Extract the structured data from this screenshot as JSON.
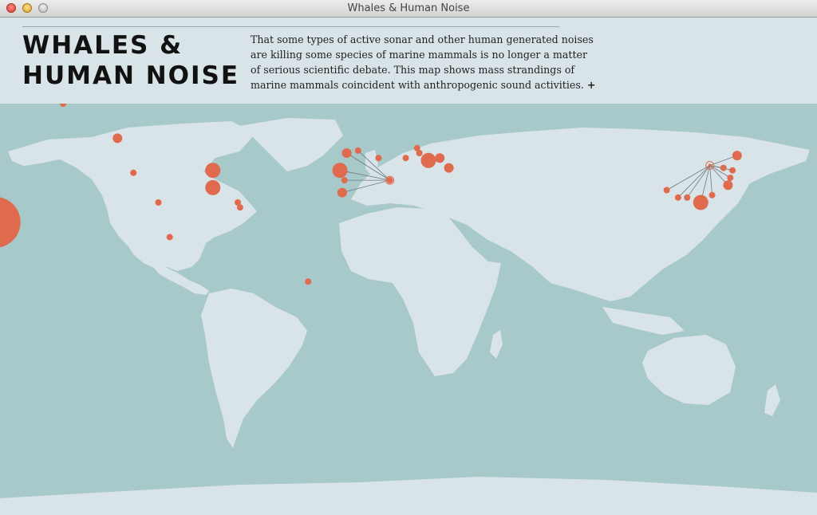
{
  "window": {
    "title": "Whales & Human Noise"
  },
  "header": {
    "title_line1": "WHALES &",
    "title_line2": "HUMAN NOISE",
    "intro_lines": [
      "That some types of active sonar and other human generated noises",
      "are killing some species of marine mammals is no longer a matter",
      "of serious scientific debate.  This map shows mass strandings of",
      "marine mammals coincident with anthropogenic sound activities."
    ],
    "more_label": "+"
  },
  "colors": {
    "ocean": "#a8c9ca",
    "land": "#d9e4e8",
    "marker": "#e06a4e",
    "leader": "#6f7a7d"
  },
  "markers": [
    {
      "lon": -178,
      "lat": 12,
      "size": 8
    },
    {
      "lon": -148,
      "lat": 60,
      "size": 1
    },
    {
      "lon": -124,
      "lat": 46,
      "size": 2
    },
    {
      "lon": -117,
      "lat": 32,
      "size": 1
    },
    {
      "lon": -106,
      "lat": 20,
      "size": 1
    },
    {
      "lon": -82,
      "lat": 33,
      "size": 3
    },
    {
      "lon": -82,
      "lat": 26,
      "size": 3
    },
    {
      "lon": -71,
      "lat": 20,
      "size": 1
    },
    {
      "lon": -70,
      "lat": 18,
      "size": 1
    },
    {
      "lon": -101,
      "lat": 6,
      "size": 1
    },
    {
      "lon": -40,
      "lat": -12,
      "size": 1
    },
    {
      "lon": -23,
      "lat": 40,
      "size": 2
    },
    {
      "lon": -18,
      "lat": 41,
      "size": 1
    },
    {
      "lon": -26,
      "lat": 33,
      "size": 3
    },
    {
      "lon": -24,
      "lat": 29,
      "size": 1
    },
    {
      "lon": -25,
      "lat": 24,
      "size": 2
    },
    {
      "lon": -4,
      "lat": 29,
      "size": 1
    },
    {
      "lon": -9,
      "lat": 38,
      "size": 1
    },
    {
      "lon": 3,
      "lat": 38,
      "size": 1
    },
    {
      "lon": 8,
      "lat": 42,
      "size": 1
    },
    {
      "lon": 9,
      "lat": 40,
      "size": 1
    },
    {
      "lon": 13,
      "lat": 37,
      "size": 3
    },
    {
      "lon": 18,
      "lat": 38,
      "size": 2
    },
    {
      "lon": 22,
      "lat": 34,
      "size": 2
    },
    {
      "lon": 143,
      "lat": 34,
      "size": 1
    },
    {
      "lon": 149,
      "lat": 39,
      "size": 2
    },
    {
      "lon": 147,
      "lat": 33,
      "size": 1
    },
    {
      "lon": 146,
      "lat": 30,
      "size": 1
    },
    {
      "lon": 145,
      "lat": 27,
      "size": 2
    },
    {
      "lon": 138,
      "lat": 23,
      "size": 1
    },
    {
      "lon": 133,
      "lat": 20,
      "size": 3
    },
    {
      "lon": 127,
      "lat": 22,
      "size": 1
    },
    {
      "lon": 123,
      "lat": 22,
      "size": 1
    },
    {
      "lon": 118,
      "lat": 25,
      "size": 1
    }
  ],
  "hubs": [
    {
      "lon": -4,
      "lat": 29,
      "spokes": [
        11,
        12,
        13,
        14,
        15
      ]
    },
    {
      "lon": 137,
      "lat": 35,
      "spokes": [
        24,
        25,
        26,
        27,
        28,
        29,
        30,
        31,
        32,
        33
      ]
    }
  ]
}
